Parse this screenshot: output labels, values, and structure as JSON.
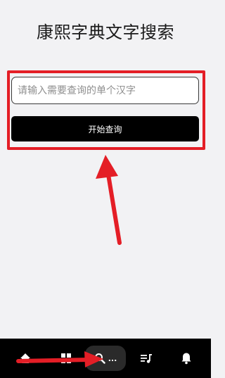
{
  "page": {
    "title": "康熙字典文字搜索"
  },
  "search": {
    "placeholder": "请输入需要查询的单个汉字",
    "value": "",
    "button_label": "开始查询"
  },
  "bottom_nav": {
    "items": [
      {
        "icon": "home-icon"
      },
      {
        "icon": "grid-icon"
      },
      {
        "icon": "search-icon",
        "label": "..."
      },
      {
        "icon": "playlist-icon"
      },
      {
        "icon": "bell-icon"
      }
    ],
    "active_index": 2
  },
  "colors": {
    "background": "#f2f2f4",
    "highlight": "#e41e26",
    "button": "#000000",
    "nav_background": "#000000"
  }
}
